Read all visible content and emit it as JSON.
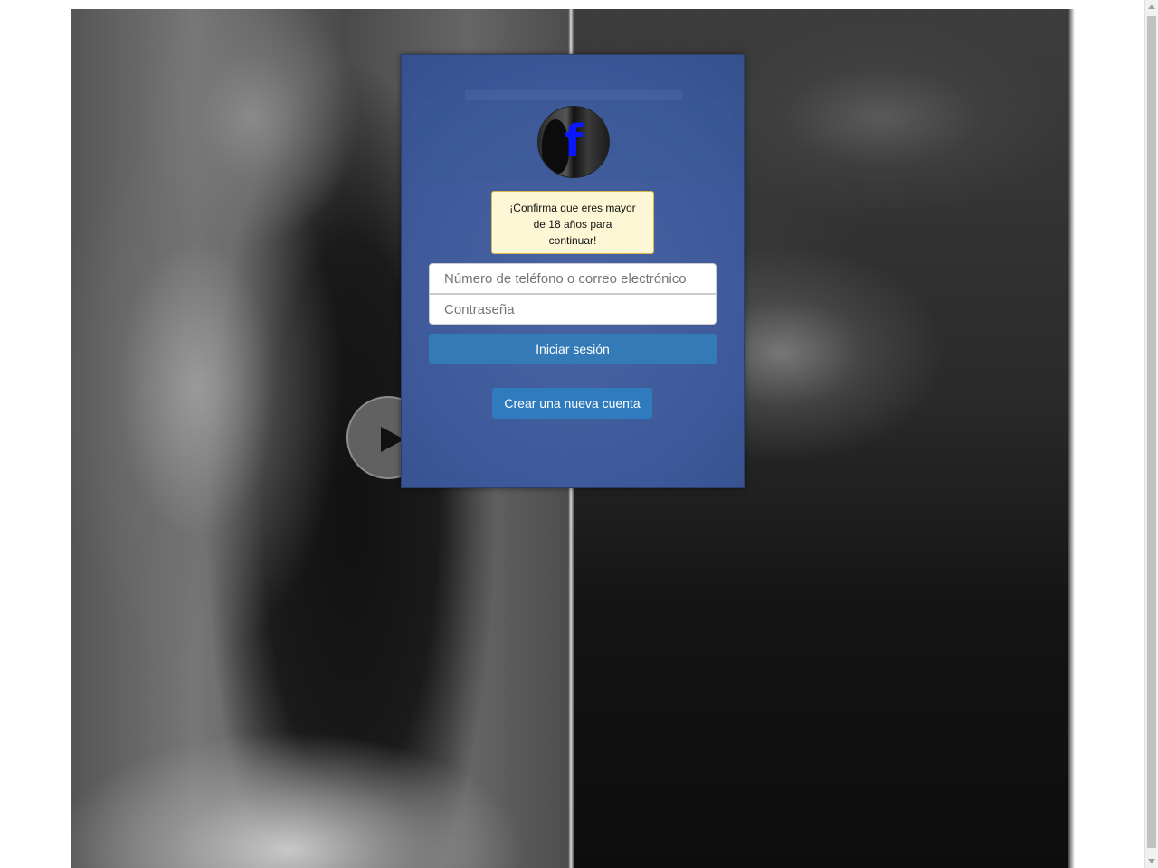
{
  "background": {
    "play_icon": "play-icon"
  },
  "login_card": {
    "logo_letter": "f",
    "age_notice": "¡Confirma que eres mayor de 18 años para continuar!",
    "email_placeholder": "Número de teléfono o correo electrónico",
    "password_placeholder": "Contraseña",
    "login_label": "Iniciar sesión",
    "create_account_label": "Crear una nueva cuenta"
  },
  "colors": {
    "card_blue": "#3e5a9a",
    "button_blue": "#337ab7",
    "notice_bg": "#fdf7d6",
    "logo_f": "#0b17ff"
  }
}
